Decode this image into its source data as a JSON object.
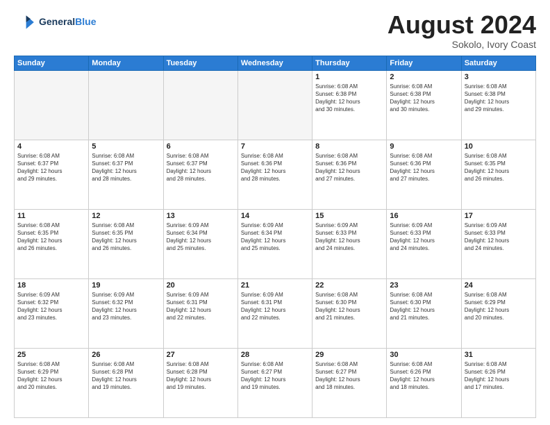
{
  "header": {
    "logo_line1": "General",
    "logo_line2": "Blue",
    "month_title": "August 2024",
    "location": "Sokolo, Ivory Coast"
  },
  "weekdays": [
    "Sunday",
    "Monday",
    "Tuesday",
    "Wednesday",
    "Thursday",
    "Friday",
    "Saturday"
  ],
  "weeks": [
    [
      {
        "day": "",
        "info": "",
        "empty": true
      },
      {
        "day": "",
        "info": "",
        "empty": true
      },
      {
        "day": "",
        "info": "",
        "empty": true
      },
      {
        "day": "",
        "info": "",
        "empty": true
      },
      {
        "day": "1",
        "info": "Sunrise: 6:08 AM\nSunset: 6:38 PM\nDaylight: 12 hours\nand 30 minutes.",
        "empty": false
      },
      {
        "day": "2",
        "info": "Sunrise: 6:08 AM\nSunset: 6:38 PM\nDaylight: 12 hours\nand 30 minutes.",
        "empty": false
      },
      {
        "day": "3",
        "info": "Sunrise: 6:08 AM\nSunset: 6:38 PM\nDaylight: 12 hours\nand 29 minutes.",
        "empty": false
      }
    ],
    [
      {
        "day": "4",
        "info": "Sunrise: 6:08 AM\nSunset: 6:37 PM\nDaylight: 12 hours\nand 29 minutes.",
        "empty": false
      },
      {
        "day": "5",
        "info": "Sunrise: 6:08 AM\nSunset: 6:37 PM\nDaylight: 12 hours\nand 28 minutes.",
        "empty": false
      },
      {
        "day": "6",
        "info": "Sunrise: 6:08 AM\nSunset: 6:37 PM\nDaylight: 12 hours\nand 28 minutes.",
        "empty": false
      },
      {
        "day": "7",
        "info": "Sunrise: 6:08 AM\nSunset: 6:36 PM\nDaylight: 12 hours\nand 28 minutes.",
        "empty": false
      },
      {
        "day": "8",
        "info": "Sunrise: 6:08 AM\nSunset: 6:36 PM\nDaylight: 12 hours\nand 27 minutes.",
        "empty": false
      },
      {
        "day": "9",
        "info": "Sunrise: 6:08 AM\nSunset: 6:36 PM\nDaylight: 12 hours\nand 27 minutes.",
        "empty": false
      },
      {
        "day": "10",
        "info": "Sunrise: 6:08 AM\nSunset: 6:35 PM\nDaylight: 12 hours\nand 26 minutes.",
        "empty": false
      }
    ],
    [
      {
        "day": "11",
        "info": "Sunrise: 6:08 AM\nSunset: 6:35 PM\nDaylight: 12 hours\nand 26 minutes.",
        "empty": false
      },
      {
        "day": "12",
        "info": "Sunrise: 6:08 AM\nSunset: 6:35 PM\nDaylight: 12 hours\nand 26 minutes.",
        "empty": false
      },
      {
        "day": "13",
        "info": "Sunrise: 6:09 AM\nSunset: 6:34 PM\nDaylight: 12 hours\nand 25 minutes.",
        "empty": false
      },
      {
        "day": "14",
        "info": "Sunrise: 6:09 AM\nSunset: 6:34 PM\nDaylight: 12 hours\nand 25 minutes.",
        "empty": false
      },
      {
        "day": "15",
        "info": "Sunrise: 6:09 AM\nSunset: 6:33 PM\nDaylight: 12 hours\nand 24 minutes.",
        "empty": false
      },
      {
        "day": "16",
        "info": "Sunrise: 6:09 AM\nSunset: 6:33 PM\nDaylight: 12 hours\nand 24 minutes.",
        "empty": false
      },
      {
        "day": "17",
        "info": "Sunrise: 6:09 AM\nSunset: 6:33 PM\nDaylight: 12 hours\nand 24 minutes.",
        "empty": false
      }
    ],
    [
      {
        "day": "18",
        "info": "Sunrise: 6:09 AM\nSunset: 6:32 PM\nDaylight: 12 hours\nand 23 minutes.",
        "empty": false
      },
      {
        "day": "19",
        "info": "Sunrise: 6:09 AM\nSunset: 6:32 PM\nDaylight: 12 hours\nand 23 minutes.",
        "empty": false
      },
      {
        "day": "20",
        "info": "Sunrise: 6:09 AM\nSunset: 6:31 PM\nDaylight: 12 hours\nand 22 minutes.",
        "empty": false
      },
      {
        "day": "21",
        "info": "Sunrise: 6:09 AM\nSunset: 6:31 PM\nDaylight: 12 hours\nand 22 minutes.",
        "empty": false
      },
      {
        "day": "22",
        "info": "Sunrise: 6:08 AM\nSunset: 6:30 PM\nDaylight: 12 hours\nand 21 minutes.",
        "empty": false
      },
      {
        "day": "23",
        "info": "Sunrise: 6:08 AM\nSunset: 6:30 PM\nDaylight: 12 hours\nand 21 minutes.",
        "empty": false
      },
      {
        "day": "24",
        "info": "Sunrise: 6:08 AM\nSunset: 6:29 PM\nDaylight: 12 hours\nand 20 minutes.",
        "empty": false
      }
    ],
    [
      {
        "day": "25",
        "info": "Sunrise: 6:08 AM\nSunset: 6:29 PM\nDaylight: 12 hours\nand 20 minutes.",
        "empty": false
      },
      {
        "day": "26",
        "info": "Sunrise: 6:08 AM\nSunset: 6:28 PM\nDaylight: 12 hours\nand 19 minutes.",
        "empty": false
      },
      {
        "day": "27",
        "info": "Sunrise: 6:08 AM\nSunset: 6:28 PM\nDaylight: 12 hours\nand 19 minutes.",
        "empty": false
      },
      {
        "day": "28",
        "info": "Sunrise: 6:08 AM\nSunset: 6:27 PM\nDaylight: 12 hours\nand 19 minutes.",
        "empty": false
      },
      {
        "day": "29",
        "info": "Sunrise: 6:08 AM\nSunset: 6:27 PM\nDaylight: 12 hours\nand 18 minutes.",
        "empty": false
      },
      {
        "day": "30",
        "info": "Sunrise: 6:08 AM\nSunset: 6:26 PM\nDaylight: 12 hours\nand 18 minutes.",
        "empty": false
      },
      {
        "day": "31",
        "info": "Sunrise: 6:08 AM\nSunset: 6:26 PM\nDaylight: 12 hours\nand 17 minutes.",
        "empty": false
      }
    ]
  ]
}
